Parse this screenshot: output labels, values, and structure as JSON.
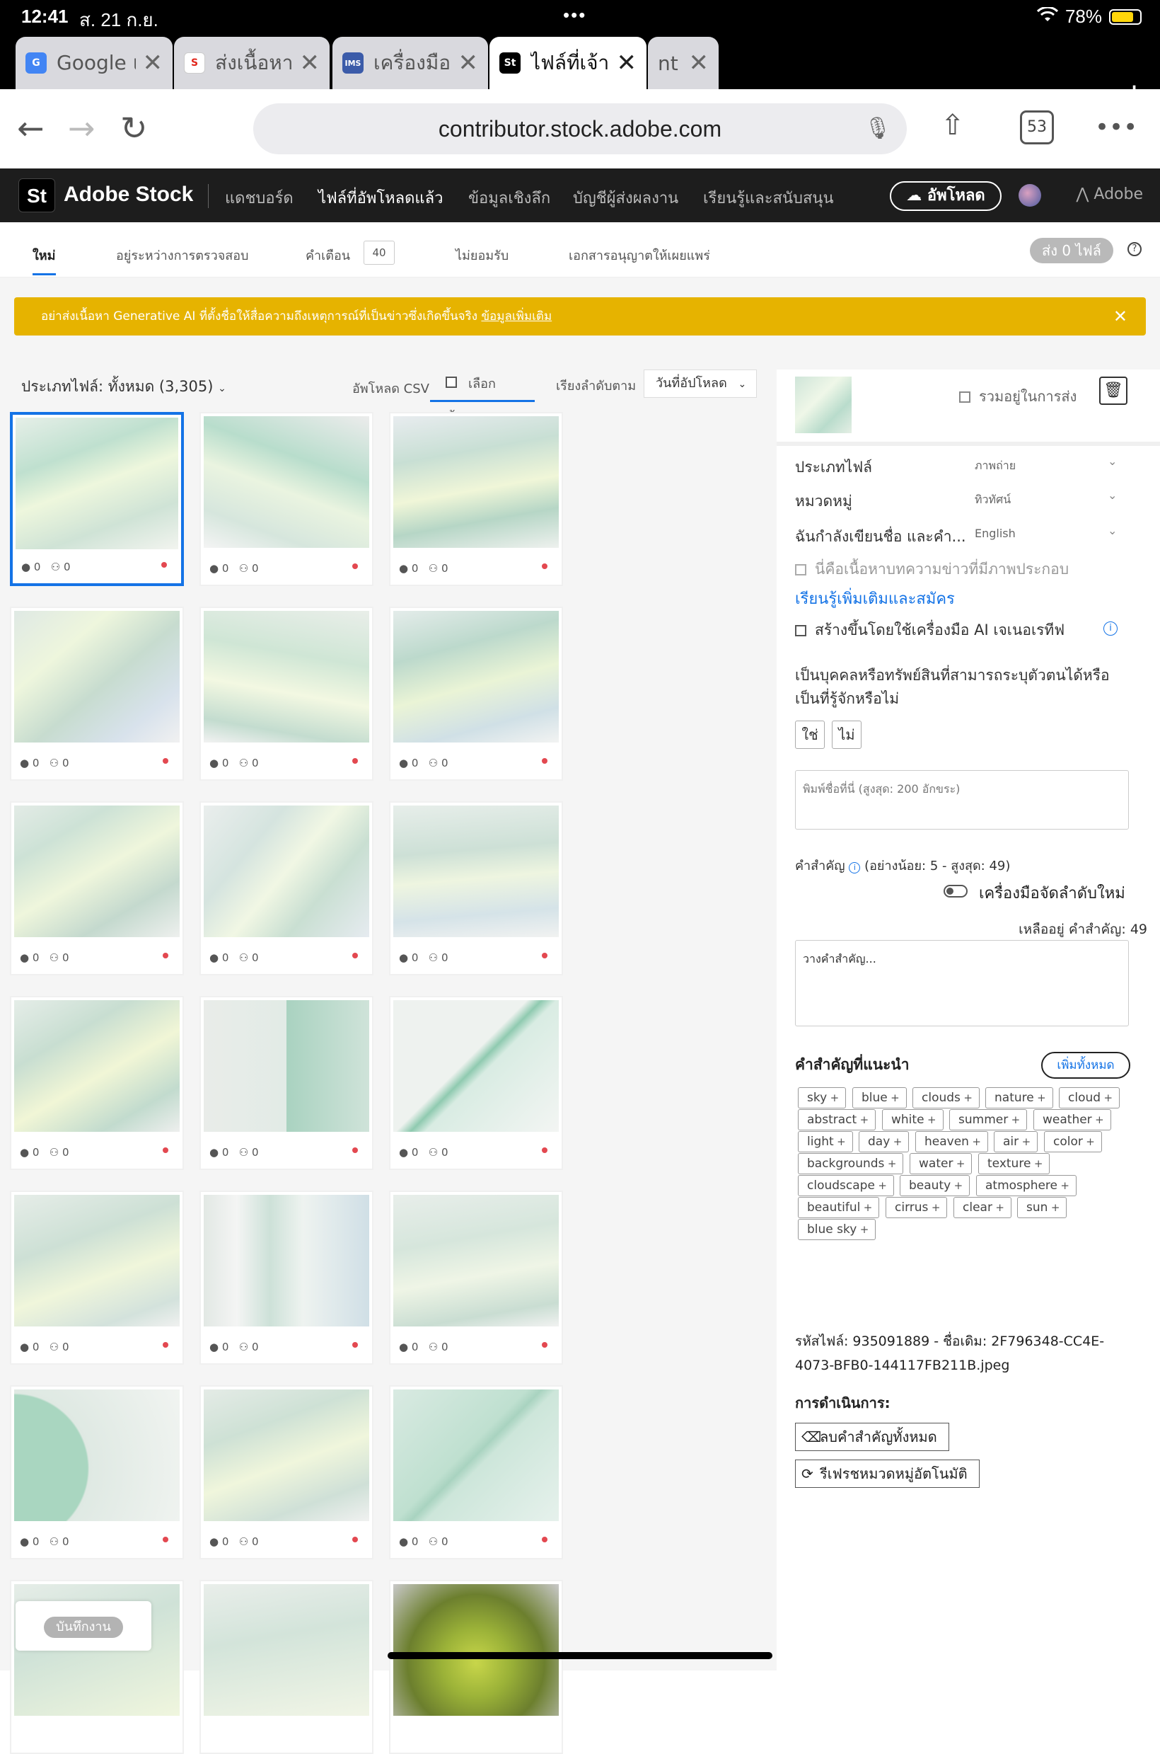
{
  "status": {
    "time": "12:41",
    "date": "ส. 21 ก.ย.",
    "battery": "78%",
    "battery_level": 0.78
  },
  "browser": {
    "tabs": [
      {
        "label": "Google แปลภาษา",
        "icon_color": "#4285f4"
      },
      {
        "label": "ส่งเนื้อหา",
        "icon_color": "#ffffff"
      },
      {
        "label": "เครื่องมือคีย์เวิร์ด",
        "icon_color": "#3b5ba9"
      },
      {
        "label": "ไฟล์ที่เจ้าของผลงาน",
        "icon_color": "#000000"
      },
      {
        "label": "nt | T",
        "icon_color": "#d9d9de"
      }
    ],
    "url": "contributor.stock.adobe.com",
    "tab_count": "53"
  },
  "app": {
    "logo": "St",
    "brand": "Adobe Stock",
    "nav": [
      "แดชบอร์ด",
      "ไฟล์ที่อัพโหลดแล้ว",
      "ข้อมูลเชิงลึก",
      "บัญชีผู้ส่งผลงาน",
      "เรียนรู้และสนับสนุน"
    ],
    "upload": "อัพโหลด",
    "adobe": "Adobe"
  },
  "subtabs": {
    "new": "ใหม่",
    "review": "อยู่ระหว่างการตรวจสอบ",
    "warnings": "คำเตือน",
    "warnings_count": "40",
    "rejected": "ไม่ยอมรับ",
    "releases": "เอกสารอนุญาตให้เผยแพร่",
    "send": "ส่ง 0 ไฟล์"
  },
  "banner": {
    "text": "อย่าส่งเนื้อหา Generative AI ที่ตั้งชื่อให้สื่อความถึงเหตุการณ์ที่เป็นข่าวซึ่งเกิดขึ้นจริง",
    "link": "ข้อมูลเพิ่มเติม"
  },
  "filter": {
    "type": "ประเภทไฟล์: ทั้งหมด (3,305)",
    "csv": "อัพโหลด CSV",
    "select_all": "เลือกทั้งหมด",
    "sort_label": "เรียงลำดับตาม",
    "sort_value": "วันที่อัปโหลด"
  },
  "thumbs": [
    {
      "tags": "0",
      "people": "0"
    },
    {
      "tags": "0",
      "people": "0"
    },
    {
      "tags": "0",
      "people": "0"
    },
    {
      "tags": "0",
      "people": "0"
    },
    {
      "tags": "0",
      "people": "0"
    },
    {
      "tags": "0",
      "people": "0"
    },
    {
      "tags": "0",
      "people": "0"
    },
    {
      "tags": "0",
      "people": "0"
    },
    {
      "tags": "0",
      "people": "0"
    },
    {
      "tags": "0",
      "people": "0"
    },
    {
      "tags": "0",
      "people": "0"
    },
    {
      "tags": "0",
      "people": "0"
    },
    {
      "tags": "0",
      "people": "0"
    },
    {
      "tags": "0",
      "people": "0"
    },
    {
      "tags": "0",
      "people": "0"
    },
    {
      "tags": "0",
      "people": "0"
    },
    {
      "tags": "0",
      "people": "0"
    },
    {
      "tags": "0",
      "people": "0"
    }
  ],
  "save_work": "บันทึกงาน",
  "panel": {
    "include": "รวมอยู่ในการส่ง",
    "file_type_label": "ประเภทไฟล์",
    "file_type_value": "ภาพถ่าย",
    "category_label": "หมวดหมู่",
    "category_value": "ทิวทัศน์",
    "language_label": "ฉันกำลังเขียนชื่อ และคำ...",
    "language_value": "English",
    "editorial": "นี่คือเนื้อหาบทความข่าวที่มีภาพประกอบ",
    "learn_more": "เรียนรู้เพิ่มเติมและสมัคร",
    "ai_generated": "สร้างขึ้นโดยใช้เครื่องมือ AI เจเนอเรทีฟ",
    "recognizable": "เป็นบุคคลหรือทรัพย์สินที่สามารถระบุตัวตนได้หรือเป็นที่รู้จักหรือไม่",
    "yes": "ใช่",
    "no": "ไม่",
    "title_placeholder": "พิมพ์ชื่อที่นี่ (สูงสุด: 200 อักขระ)",
    "keywords_label": "คำสำคัญ",
    "keywords_hint": "(อย่างน้อย: 5 - สูงสุด: 49)",
    "new_tool": "เครื่องมือจัดลำดับใหม่",
    "remaining": "เหลืออยู่ คำสำคัญ: 49",
    "keywords_placeholder": "วางคำสำคัญ...",
    "suggested": "คำสำคัญที่แนะนำ",
    "add_all": "เพิ่มทั้งหมด",
    "suggested_keywords": [
      "sky",
      "blue",
      "clouds",
      "nature",
      "cloud",
      "abstract",
      "white",
      "summer",
      "weather",
      "light",
      "day",
      "heaven",
      "air",
      "color",
      "backgrounds",
      "water",
      "texture",
      "cloudscape",
      "beauty",
      "atmosphere",
      "beautiful",
      "cirrus",
      "clear",
      "sun",
      "blue sky"
    ],
    "file_id": "รหัสไฟล์: 935091889 - ชื่อเดิม: 2F796348-CC4E-4073-BFB0-144117FB211B.jpeg",
    "actions_label": "การดำเนินการ:",
    "clear_keywords": "ลบคำสำคัญทั้งหมด",
    "refresh_category": "รีเฟรชหมวดหมู่อัตโนมัติ"
  }
}
